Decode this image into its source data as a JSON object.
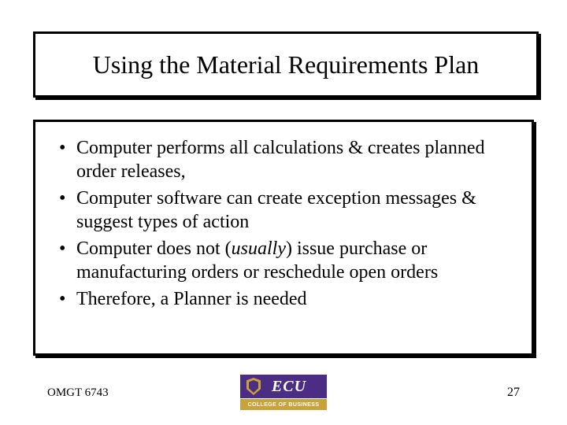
{
  "title": "Using the Material Requirements Plan",
  "bullets": [
    {
      "pre": "Computer performs all calculations & creates planned order releases,",
      "em": "",
      "post": ""
    },
    {
      "pre": "Computer software can create exception messages & suggest types of action",
      "em": "",
      "post": ""
    },
    {
      "pre": "Computer does not (",
      "em": "usually",
      "post": ") issue purchase or manufacturing orders or reschedule open orders"
    },
    {
      "pre": "Therefore, a Planner is needed",
      "em": "",
      "post": ""
    }
  ],
  "footer": {
    "course": "OMGT 6743",
    "page": "27"
  },
  "logo": {
    "acronym": "ECU",
    "subline": "COLLEGE OF BUSINESS"
  }
}
